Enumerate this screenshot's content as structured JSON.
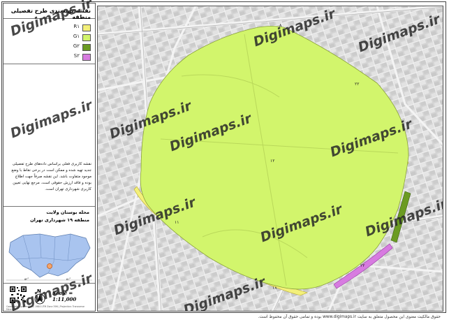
{
  "sidebar": {
    "title": "نقشه پهنه‌بندی طرح تفصیلی منطقه",
    "legend": [
      {
        "label": "پهنه R",
        "code": "R۱",
        "color": "#f3f07a"
      },
      {
        "label": "پهنه G",
        "code": "G۱",
        "color": "#d2f56c"
      },
      {
        "label": "پهنه G",
        "code": "G۲",
        "color": "#6b9b22"
      },
      {
        "label": "پهنه S",
        "code": "S۲",
        "color": "#d77be0"
      }
    ],
    "description": "نقشه کاربری فعلی براساس داده‌های طرح تفصیلی جدید تهیه شده و ممکن است در برخی نقاط با وضع موجود متفاوت باشد. این نقشه صرفاً جهت اطلاع بوده و فاقد ارزش حقوقی است. مرجع نهایی تعیین کاربری شهرداری تهران است.",
    "location_line1": "محله بوستان ولایت",
    "location_line2": "منطقه ۱۹ شهرداری تهران",
    "scale": "Scale = 1:11,000",
    "credit": "Coordinate System: WGS 1984 UTM Zone 39N | Projection: Transverse Mercator",
    "inset_labels": [
      "۵۲°",
      "۵۱°"
    ]
  },
  "map": {
    "watermark": "Digimaps.ir",
    "zone_labels": [
      "۱۲",
      "۲۲",
      "۲۲",
      "۸",
      "۱۱",
      "۱۸"
    ]
  },
  "footer_note": "حقوق مالکیت معنوی این محصول متعلق به سایت www.digimaps.ir بوده و تمامی حقوق آن محفوظ است."
}
